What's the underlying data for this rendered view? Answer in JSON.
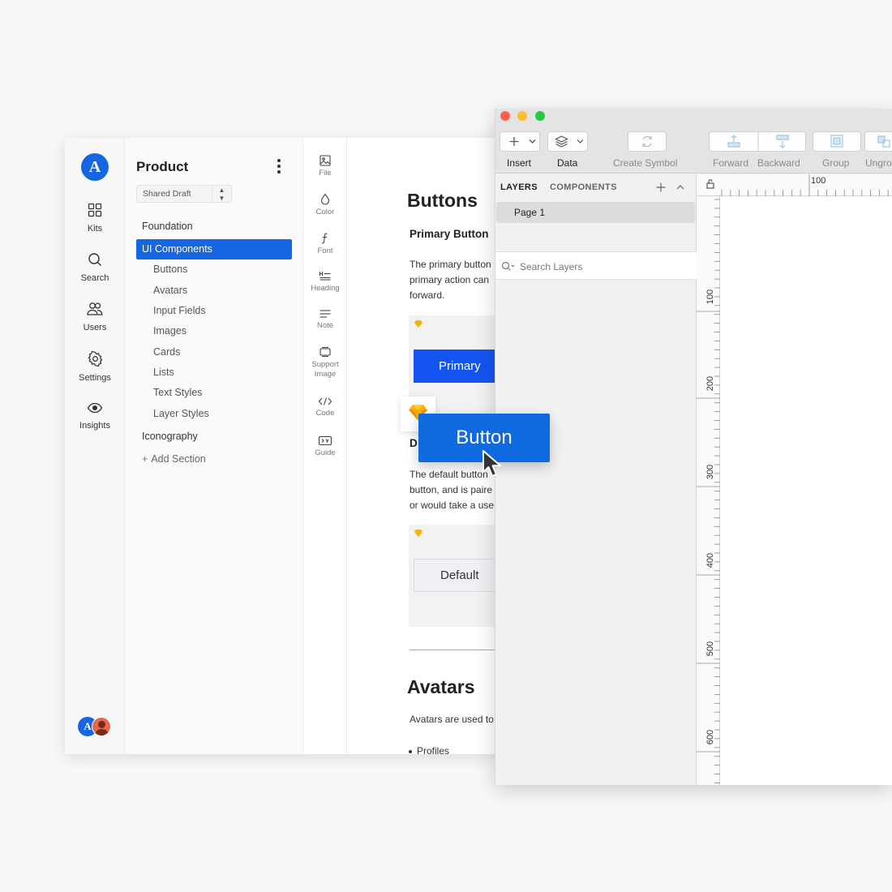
{
  "app": {
    "logo_letter": "A"
  },
  "rail": [
    {
      "label": "Kits",
      "icon": "grid-icon"
    },
    {
      "label": "Search",
      "icon": "search-icon"
    },
    {
      "label": "Users",
      "icon": "users-icon"
    },
    {
      "label": "Settings",
      "icon": "gear-icon"
    },
    {
      "label": "Insights",
      "icon": "eye-icon"
    }
  ],
  "avatars": {
    "first_letter": "A"
  },
  "nav": {
    "title": "Product",
    "draft_select": "Shared Draft",
    "items": [
      {
        "label": "Foundation",
        "level": 0,
        "active": false
      },
      {
        "label": "UI Components",
        "level": 0,
        "active": true
      },
      {
        "label": "Buttons",
        "level": 1,
        "active": false
      },
      {
        "label": "Avatars",
        "level": 1,
        "active": false
      },
      {
        "label": "Input Fields",
        "level": 1,
        "active": false
      },
      {
        "label": "Images",
        "level": 1,
        "active": false
      },
      {
        "label": "Cards",
        "level": 1,
        "active": false
      },
      {
        "label": "Lists",
        "level": 1,
        "active": false
      },
      {
        "label": "Text Styles",
        "level": 1,
        "active": false
      },
      {
        "label": "Layer Styles",
        "level": 1,
        "active": false
      },
      {
        "label": "Iconography",
        "level": 0,
        "active": false
      }
    ],
    "add_section": "Add Section"
  },
  "tools": [
    {
      "label": "File",
      "icon": "file-image-icon"
    },
    {
      "label": "Color",
      "icon": "droplet-icon"
    },
    {
      "label": "Font",
      "icon": "font-icon"
    },
    {
      "label": "Heading",
      "icon": "heading-icon"
    },
    {
      "label": "Note",
      "icon": "note-icon"
    },
    {
      "label": "Support Image",
      "icon": "support-image-icon"
    },
    {
      "label": "Code",
      "icon": "code-icon"
    },
    {
      "label": "Guide",
      "icon": "guide-icon"
    }
  ],
  "content": {
    "heading": "Buttons",
    "primary_heading": "Primary Button",
    "primary_text": [
      "The primary button",
      "primary action can",
      "forward."
    ],
    "primary_button": "Primary",
    "default_heading_fragment": "D",
    "default_text": [
      "The default button",
      "button, and is paire",
      "or would take a use"
    ],
    "default_button": "Default",
    "avatars_heading": "Avatars",
    "avatars_text": "Avatars are used to",
    "bullet": "Profiles"
  },
  "sketch": {
    "toolbar": {
      "insert": "Insert",
      "data": "Data",
      "create_symbol": "Create Symbol",
      "forward": "Forward",
      "backward": "Backward",
      "group": "Group",
      "ungroup": "Ungro"
    },
    "tabs": {
      "layers": "LAYERS",
      "components": "COMPONENTS"
    },
    "page": "Page 1",
    "search_placeholder": "Search Layers",
    "ruler_top": "100",
    "ruler_left": [
      "100",
      "200",
      "300",
      "400",
      "500",
      "600"
    ]
  },
  "drag": {
    "label": "Button"
  },
  "colors": {
    "accent": "#1566e0",
    "primary_button": "#1454f0",
    "drag_button": "#0e6ade",
    "sketch_gem": "#f7b500"
  }
}
